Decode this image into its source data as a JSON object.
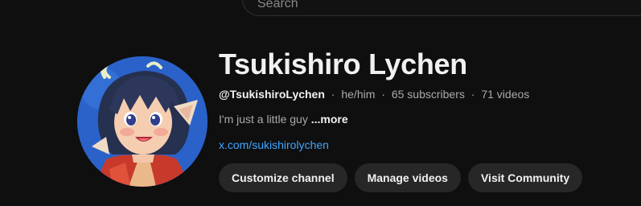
{
  "search": {
    "placeholder": "Search"
  },
  "channel": {
    "avatar_icon": "channel-avatar-anime-character",
    "name": "Tsukishiro Lychen",
    "handle": "@TsukishiroLychen",
    "separator": "·",
    "pronouns": "he/him",
    "subscribers": "65 subscribers",
    "videos": "71 videos",
    "description": "I'm just a little guy",
    "more_label": "...more",
    "link": "x.com/sukishirolychen"
  },
  "actions": {
    "customize_label": "Customize channel",
    "manage_label": "Manage videos",
    "community_label": "Visit Community"
  },
  "colors": {
    "background": "#0f0f0f",
    "button_bg": "#272727",
    "link": "#3ea6ff",
    "muted_text": "#aaaaaa",
    "avatar_bg": "#2a62c9"
  }
}
